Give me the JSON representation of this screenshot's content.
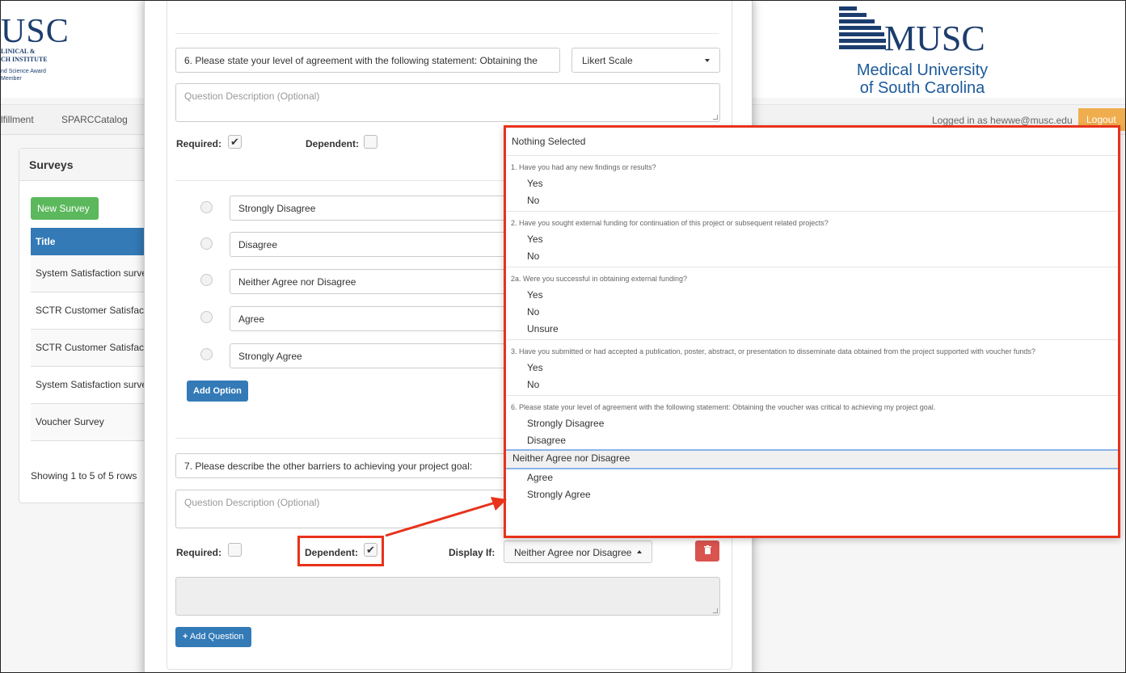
{
  "background": {
    "logo_left": {
      "big": "USC",
      "line1": "LINICAL &",
      "line2": "CH INSTITUTE",
      "line3": "nd Science Award",
      "line4": "Member"
    },
    "logo_right": {
      "mark": "MUSC",
      "sub1": "Medical University",
      "sub2": "of South Carolina"
    },
    "nav": {
      "item1": "lfillment",
      "item2": "SPARCCatalog",
      "user": "Logged in as hewwe@musc.edu",
      "logout": "Logout"
    },
    "surveys": {
      "title": "Surveys",
      "new_button": "New Survey",
      "column": "Title",
      "rows": [
        "System Satisfaction surve",
        "SCTR Customer Satisfact",
        "SCTR Customer Satisfact",
        "System Satisfaction surve",
        "Voucher Survey"
      ],
      "showing": "Showing 1 to 5 of 5 rows"
    }
  },
  "q6": {
    "text": "6. Please state your level of agreement with the following statement: Obtaining the",
    "type": "Likert Scale",
    "description_placeholder": "Question Description (Optional)",
    "required_label": "Required:",
    "required": true,
    "dependent_label": "Dependent:",
    "dependent": false,
    "options": [
      "Strongly Disagree",
      "Disagree",
      "Neither Agree nor Disagree",
      "Agree",
      "Strongly Agree"
    ],
    "add_option": "Add Option"
  },
  "q7": {
    "text": "7. Please describe the other barriers to achieving your project goal:",
    "description_placeholder": "Question Description (Optional)",
    "required_label": "Required:",
    "required": false,
    "dependent_label": "Dependent:",
    "dependent": true,
    "display_if_label": "Display If:",
    "display_if_value": "Neither Agree nor Disagree"
  },
  "add_question": "Add Question",
  "dropdown": {
    "none": "Nothing Selected",
    "groups": [
      {
        "header": "1. Have you had any new findings or results?",
        "options": [
          "Yes",
          "No"
        ]
      },
      {
        "header": "2. Have you sought external funding for continuation of this project or subsequent related projects?",
        "options": [
          "Yes",
          "No"
        ]
      },
      {
        "header": "2a. Were you successful in obtaining external funding?",
        "options": [
          "Yes",
          "No",
          "Unsure"
        ]
      },
      {
        "header": "3. Have you submitted or had accepted a publication, poster, abstract, or presentation to disseminate data obtained from the project supported with voucher funds?",
        "options": [
          "Yes",
          "No"
        ]
      },
      {
        "header": "6. Please state your level of agreement with the following statement: Obtaining the voucher was critical to achieving my project goal.",
        "options": [
          "Strongly Disagree",
          "Disagree",
          "Neither Agree nor Disagree",
          "Agree",
          "Strongly Agree"
        ]
      }
    ],
    "selected": "Neither Agree nor Disagree"
  },
  "colors": {
    "primary": "#337ab7",
    "success": "#5cb85c",
    "danger": "#d9534f",
    "warning": "#f0ad4e",
    "highlight": "#e8321a",
    "brand": "#1c3d6e"
  }
}
